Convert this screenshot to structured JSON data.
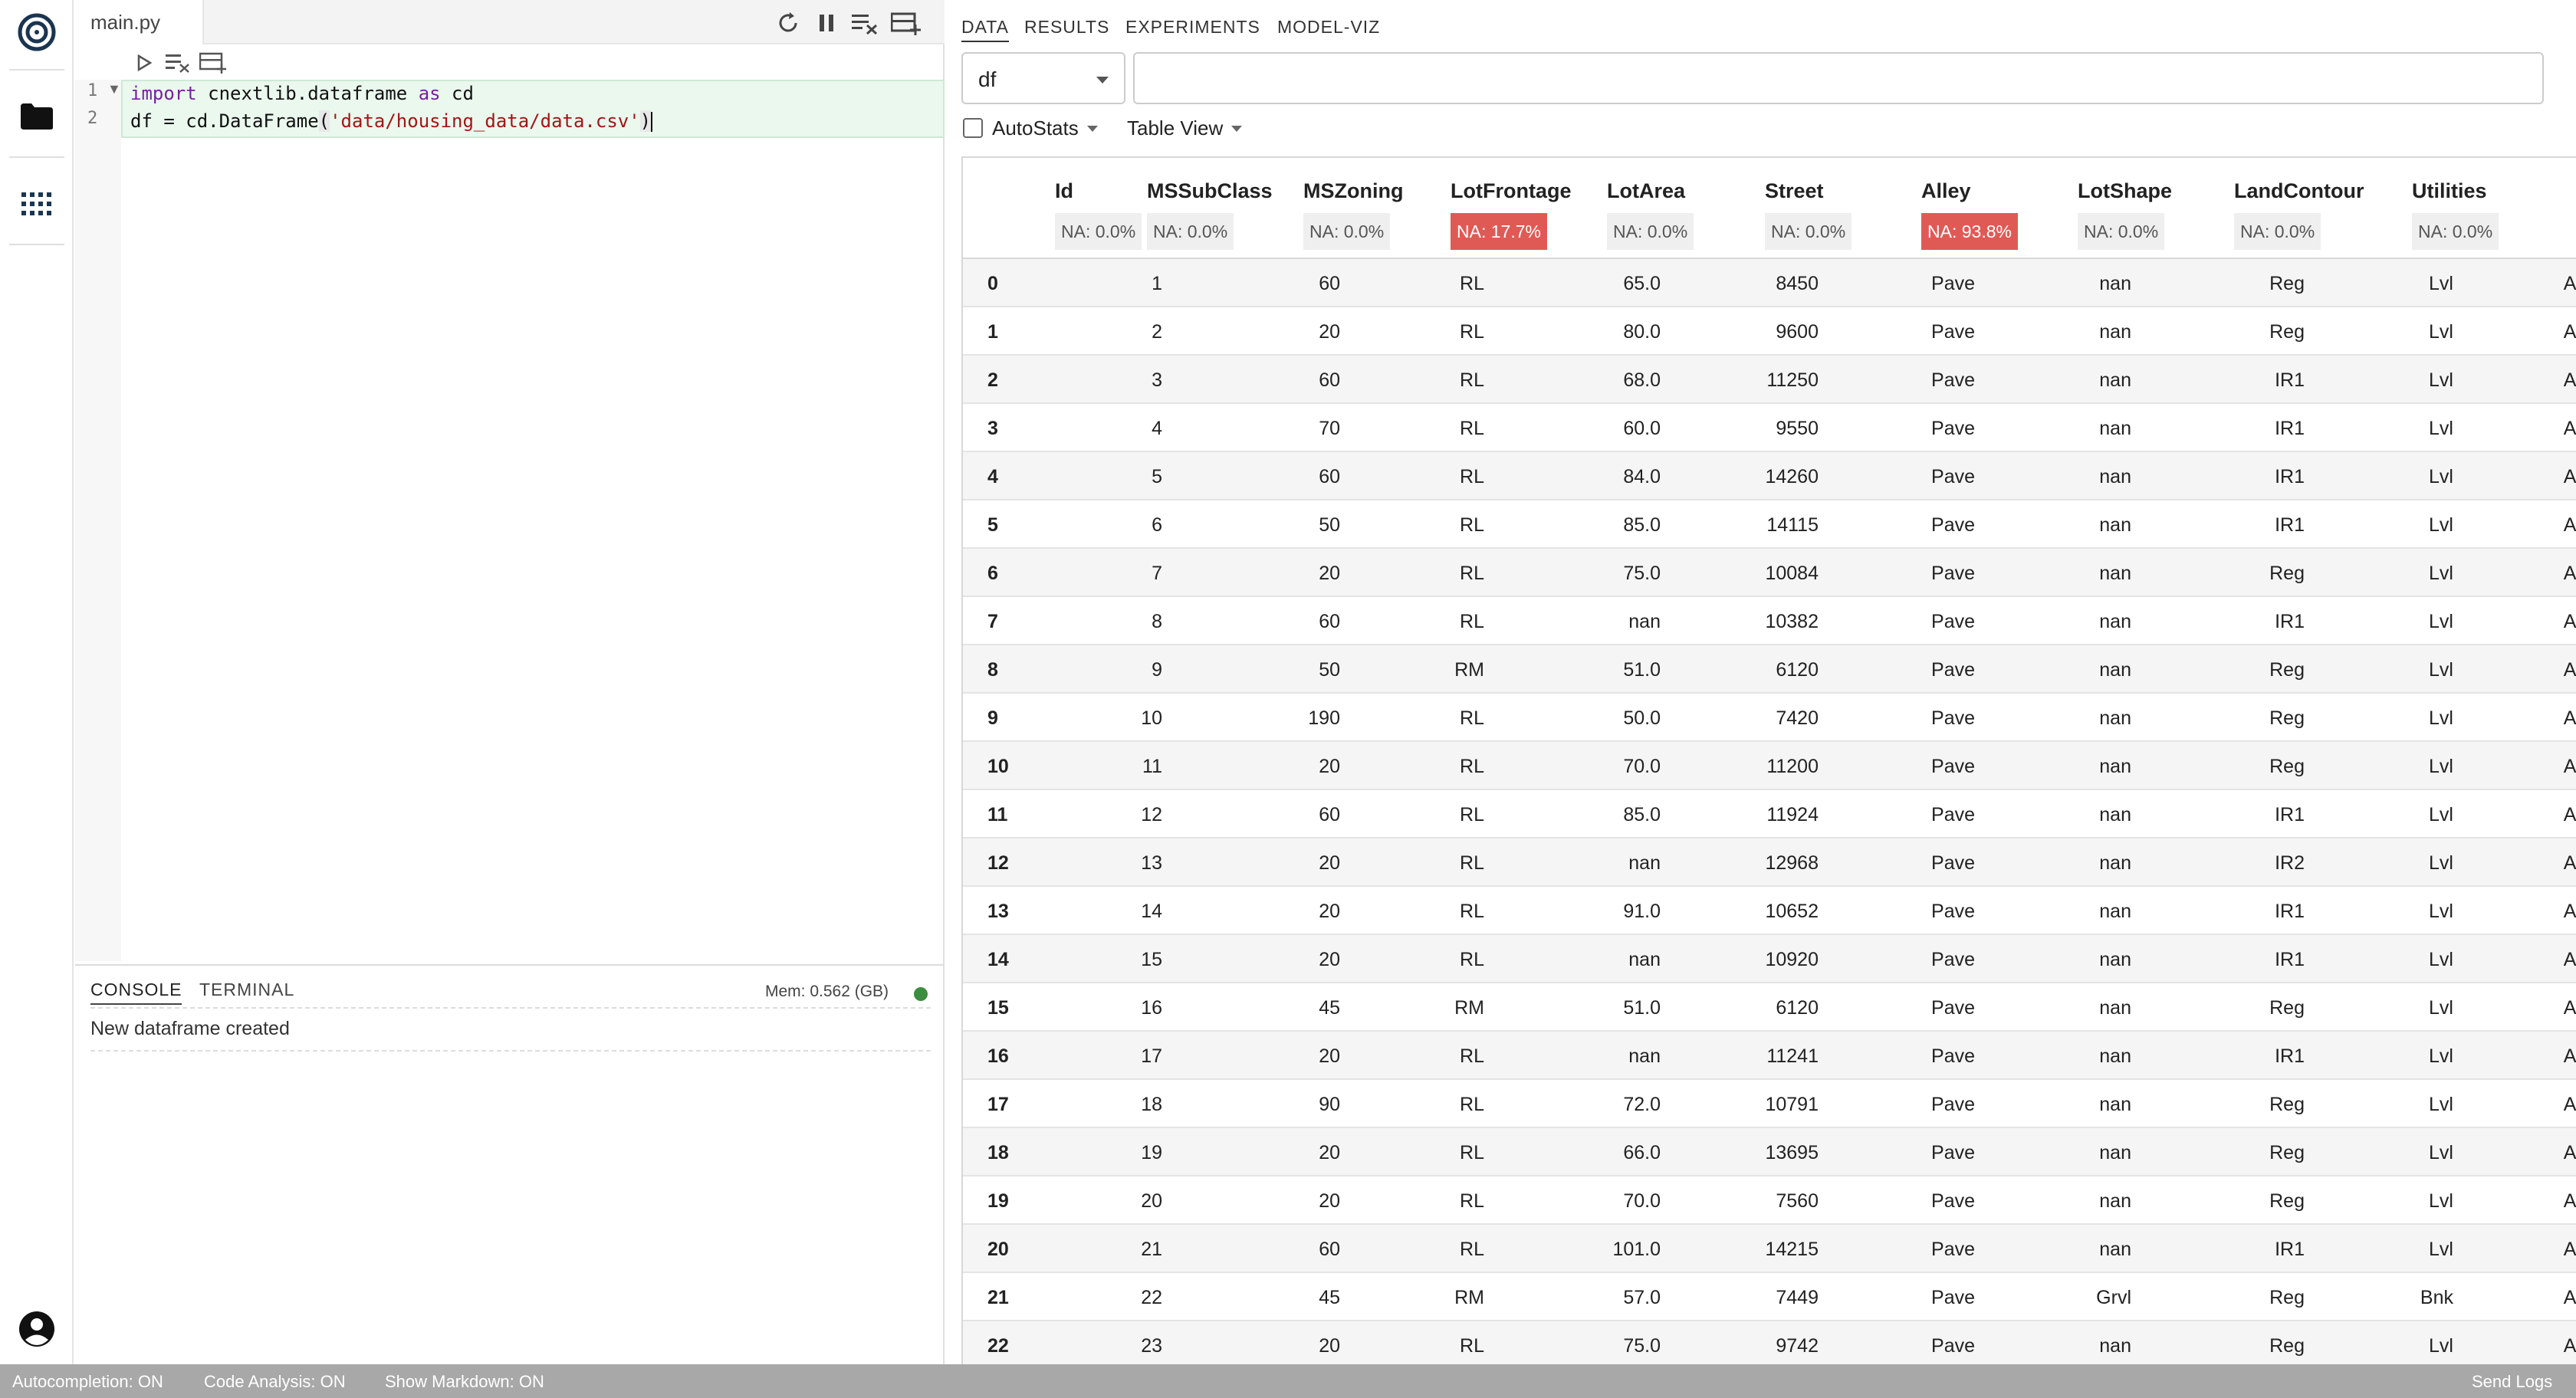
{
  "editor": {
    "file_tab": "main.py",
    "line_numbers": [
      "1",
      "2"
    ],
    "code": {
      "line1_kw_import": "import",
      "line1_module": " cnextlib.dataframe ",
      "line1_kw_as": "as",
      "line1_alias": " cd",
      "line2_prefix": "df = cd.DataFrame",
      "line2_open": "(",
      "line2_string": "'data/housing_data/data.csv'",
      "line2_close": ")"
    }
  },
  "console": {
    "tabs": [
      "CONSOLE",
      "TERMINAL"
    ],
    "mem": "Mem: 0.562 (GB)",
    "status_color": "#3c8d40",
    "message": "New dataframe created"
  },
  "right": {
    "tabs": [
      "DATA",
      "RESULTS",
      "EXPERIMENTS",
      "MODEL-VIZ"
    ],
    "df_select": "df",
    "query_value": "",
    "autostats_label": "AutoStats",
    "autostats_checked": false,
    "table_view_label": "Table View"
  },
  "table": {
    "columns": [
      {
        "name": "Id",
        "na": "NA: 0.0%",
        "warn": false
      },
      {
        "name": "MSSubClass",
        "na": "NA: 0.0%",
        "warn": false
      },
      {
        "name": "MSZoning",
        "na": "NA: 0.0%",
        "warn": false
      },
      {
        "name": "LotFrontage",
        "na": "NA: 17.7%",
        "warn": true
      },
      {
        "name": "LotArea",
        "na": "NA: 0.0%",
        "warn": false
      },
      {
        "name": "Street",
        "na": "NA: 0.0%",
        "warn": false
      },
      {
        "name": "Alley",
        "na": "NA: 93.8%",
        "warn": true
      },
      {
        "name": "LotShape",
        "na": "NA: 0.0%",
        "warn": false
      },
      {
        "name": "LandContour",
        "na": "NA: 0.0%",
        "warn": false
      },
      {
        "name": "Utilities",
        "na": "NA: 0.0%",
        "warn": false
      }
    ],
    "rows": [
      [
        "0",
        "1",
        "60",
        "RL",
        "65.0",
        "8450",
        "Pave",
        "nan",
        "Reg",
        "Lvl",
        "AllPub"
      ],
      [
        "1",
        "2",
        "20",
        "RL",
        "80.0",
        "9600",
        "Pave",
        "nan",
        "Reg",
        "Lvl",
        "AllPub"
      ],
      [
        "2",
        "3",
        "60",
        "RL",
        "68.0",
        "11250",
        "Pave",
        "nan",
        "IR1",
        "Lvl",
        "AllPub"
      ],
      [
        "3",
        "4",
        "70",
        "RL",
        "60.0",
        "9550",
        "Pave",
        "nan",
        "IR1",
        "Lvl",
        "AllPub"
      ],
      [
        "4",
        "5",
        "60",
        "RL",
        "84.0",
        "14260",
        "Pave",
        "nan",
        "IR1",
        "Lvl",
        "AllPub"
      ],
      [
        "5",
        "6",
        "50",
        "RL",
        "85.0",
        "14115",
        "Pave",
        "nan",
        "IR1",
        "Lvl",
        "AllPub"
      ],
      [
        "6",
        "7",
        "20",
        "RL",
        "75.0",
        "10084",
        "Pave",
        "nan",
        "Reg",
        "Lvl",
        "AllPub"
      ],
      [
        "7",
        "8",
        "60",
        "RL",
        "nan",
        "10382",
        "Pave",
        "nan",
        "IR1",
        "Lvl",
        "AllPub"
      ],
      [
        "8",
        "9",
        "50",
        "RM",
        "51.0",
        "6120",
        "Pave",
        "nan",
        "Reg",
        "Lvl",
        "AllPub"
      ],
      [
        "9",
        "10",
        "190",
        "RL",
        "50.0",
        "7420",
        "Pave",
        "nan",
        "Reg",
        "Lvl",
        "AllPub"
      ],
      [
        "10",
        "11",
        "20",
        "RL",
        "70.0",
        "11200",
        "Pave",
        "nan",
        "Reg",
        "Lvl",
        "AllPub"
      ],
      [
        "11",
        "12",
        "60",
        "RL",
        "85.0",
        "11924",
        "Pave",
        "nan",
        "IR1",
        "Lvl",
        "AllPub"
      ],
      [
        "12",
        "13",
        "20",
        "RL",
        "nan",
        "12968",
        "Pave",
        "nan",
        "IR2",
        "Lvl",
        "AllPub"
      ],
      [
        "13",
        "14",
        "20",
        "RL",
        "91.0",
        "10652",
        "Pave",
        "nan",
        "IR1",
        "Lvl",
        "AllPub"
      ],
      [
        "14",
        "15",
        "20",
        "RL",
        "nan",
        "10920",
        "Pave",
        "nan",
        "IR1",
        "Lvl",
        "AllPub"
      ],
      [
        "15",
        "16",
        "45",
        "RM",
        "51.0",
        "6120",
        "Pave",
        "nan",
        "Reg",
        "Lvl",
        "AllPub"
      ],
      [
        "16",
        "17",
        "20",
        "RL",
        "nan",
        "11241",
        "Pave",
        "nan",
        "IR1",
        "Lvl",
        "AllPub"
      ],
      [
        "17",
        "18",
        "90",
        "RL",
        "72.0",
        "10791",
        "Pave",
        "nan",
        "Reg",
        "Lvl",
        "AllPub"
      ],
      [
        "18",
        "19",
        "20",
        "RL",
        "66.0",
        "13695",
        "Pave",
        "nan",
        "Reg",
        "Lvl",
        "AllPub"
      ],
      [
        "19",
        "20",
        "20",
        "RL",
        "70.0",
        "7560",
        "Pave",
        "nan",
        "Reg",
        "Lvl",
        "AllPub"
      ],
      [
        "20",
        "21",
        "60",
        "RL",
        "101.0",
        "14215",
        "Pave",
        "nan",
        "IR1",
        "Lvl",
        "AllPub"
      ],
      [
        "21",
        "22",
        "45",
        "RM",
        "57.0",
        "7449",
        "Pave",
        "Grvl",
        "Reg",
        "Bnk",
        "AllPub"
      ],
      [
        "22",
        "23",
        "20",
        "RL",
        "75.0",
        "9742",
        "Pave",
        "nan",
        "Reg",
        "Lvl",
        "AllPub"
      ]
    ]
  },
  "statusbar": {
    "autocompletion": "Autocompletion: ON",
    "code_analysis": "Code Analysis: ON",
    "show_markdown": "Show Markdown: ON",
    "send_logs": "Send Logs"
  }
}
